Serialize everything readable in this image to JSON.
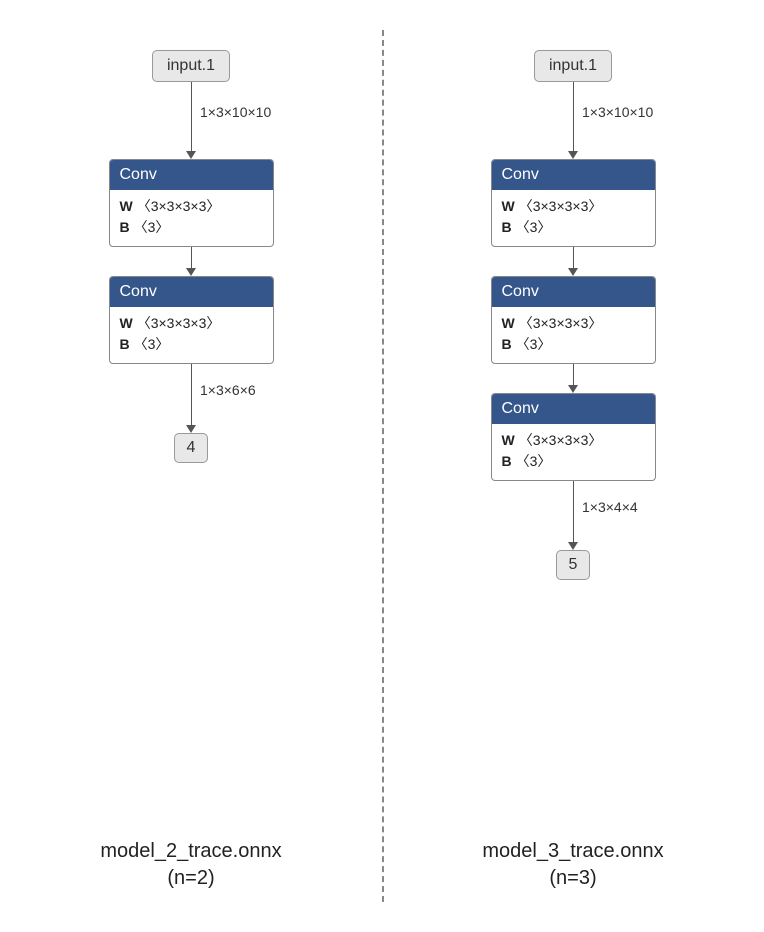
{
  "left": {
    "input_label": "input.1",
    "input_shape": "1×3×10×10",
    "nodes": [
      {
        "op": "Conv",
        "w_label": "W",
        "w_shape": "〈3×3×3×3〉",
        "b_label": "B",
        "b_shape": "〈3〉"
      },
      {
        "op": "Conv",
        "w_label": "W",
        "w_shape": "〈3×3×3×3〉",
        "b_label": "B",
        "b_shape": "〈3〉"
      }
    ],
    "output_shape": "1×3×6×6",
    "output_label": "4",
    "caption_line1": "model_2_trace.onnx",
    "caption_line2": "(n=2)"
  },
  "right": {
    "input_label": "input.1",
    "input_shape": "1×3×10×10",
    "nodes": [
      {
        "op": "Conv",
        "w_label": "W",
        "w_shape": "〈3×3×3×3〉",
        "b_label": "B",
        "b_shape": "〈3〉"
      },
      {
        "op": "Conv",
        "w_label": "W",
        "w_shape": "〈3×3×3×3〉",
        "b_label": "B",
        "b_shape": "〈3〉"
      },
      {
        "op": "Conv",
        "w_label": "W",
        "w_shape": "〈3×3×3×3〉",
        "b_label": "B",
        "b_shape": "〈3〉"
      }
    ],
    "output_shape": "1×3×4×4",
    "output_label": "5",
    "caption_line1": "model_3_trace.onnx",
    "caption_line2": "(n=3)"
  }
}
